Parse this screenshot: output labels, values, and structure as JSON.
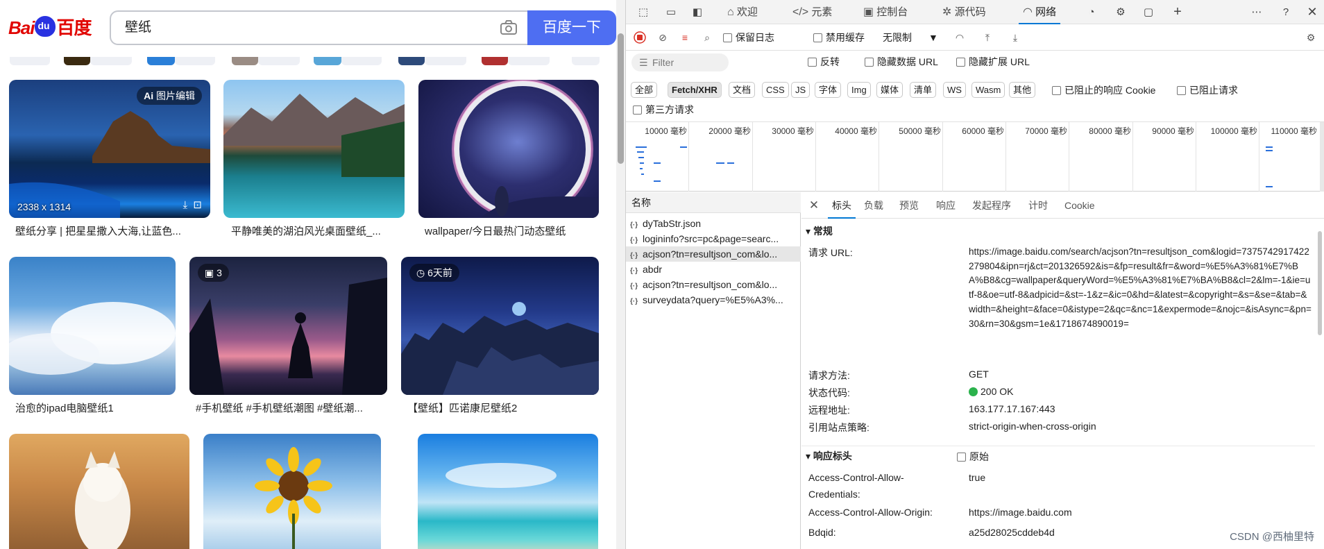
{
  "browser": {
    "logo_text": "Bai",
    "logo_cn": "百度",
    "search_value": "壁纸",
    "search_button": "百度一下",
    "images": [
      {
        "caption": "壁纸分享 | 把星星撒入大海,让蓝色...",
        "badge": "图片编辑",
        "size": "2338 x 1314"
      },
      {
        "caption": "平静唯美的湖泊风光桌面壁纸_..."
      },
      {
        "caption": "wallpaper/今日最热门动态壁纸"
      },
      {
        "caption": "治愈的ipad电脑壁纸1"
      },
      {
        "caption": "#手机壁纸 #手机壁纸潮图 #壁纸潮...",
        "badge": "3"
      },
      {
        "caption": "【壁纸】匹诺康尼壁纸2",
        "badge": "6天前"
      },
      {
        "caption": ""
      },
      {
        "caption": ""
      },
      {
        "caption": ""
      }
    ]
  },
  "devtools": {
    "tabs": [
      "欢迎",
      "元素",
      "控制台",
      "源代码",
      "网络"
    ],
    "active_tab": "网络",
    "toolbar": {
      "preserve_log": "保留日志",
      "disable_cache": "禁用缓存",
      "throttle": "无限制"
    },
    "filter": {
      "placeholder": "Filter",
      "invert": "反转",
      "hide_data_url": "隐藏数据 URL",
      "hide_ext_url": "隐藏扩展 URL"
    },
    "type_filters": [
      "全部",
      "Fetch/XHR",
      "文档",
      "CSS",
      "JS",
      "字体",
      "Img",
      "媒体",
      "清单",
      "WS",
      "Wasm",
      "其他"
    ],
    "active_type": "Fetch/XHR",
    "blocked_cookies": "已阻止的响应 Cookie",
    "blocked_requests": "已阻止请求",
    "third_party": "第三方请求",
    "timeline_labels": [
      "10000 毫秒",
      "20000 毫秒",
      "30000 毫秒",
      "40000 毫秒",
      "50000 毫秒",
      "60000 毫秒",
      "70000 毫秒",
      "80000 毫秒",
      "90000 毫秒",
      "100000 毫秒",
      "110000 毫秒"
    ],
    "name_header": "名称",
    "requests": [
      "dyTabStr.json",
      "logininfo?src=pc&page=searc...",
      "acjson?tn=resultjson_com&lo...",
      "abdr",
      "acjson?tn=resultjson_com&lo...",
      "surveydata?query=%E5%A3%..."
    ],
    "detail_tabs": [
      "标头",
      "负载",
      "预览",
      "响应",
      "发起程序",
      "计时",
      "Cookie"
    ],
    "general": {
      "title": "常规",
      "request_url_label": "请求 URL:",
      "request_url": "https://image.baidu.com/search/acjson?tn=resultjson_com&logid=7375742917422279804&ipn=rj&ct=201326592&is=&fp=result&fr=&word=%E5%A3%81%E7%BA%B8&cg=wallpaper&queryWord=%E5%A3%81%E7%BA%B8&cl=2&lm=-1&ie=utf-8&oe=utf-8&adpicid=&st=-1&z=&ic=0&hd=&latest=&copyright=&s=&se=&tab=&width=&height=&face=0&istype=2&qc=&nc=1&expermode=&nojc=&isAsync=&pn=30&rn=30&gsm=1e&1718674890019=",
      "method_label": "请求方法:",
      "method": "GET",
      "status_label": "状态代码:",
      "status": "200 OK",
      "remote_label": "远程地址:",
      "remote": "163.177.17.167:443",
      "referrer_label": "引用站点策略:",
      "referrer": "strict-origin-when-cross-origin"
    },
    "response_headers": {
      "title": "响应标头",
      "raw": "原始",
      "acac_label_1": "Access-Control-Allow-",
      "acac_label_2": "Credentials:",
      "acac": "true",
      "acao_label": "Access-Control-Allow-Origin:",
      "acao": "https://image.baidu.com",
      "bdqid_label": "Bdqid:",
      "bdqid": "a25d28025cddeb4d"
    }
  },
  "watermark": "CSDN @西柚里特"
}
